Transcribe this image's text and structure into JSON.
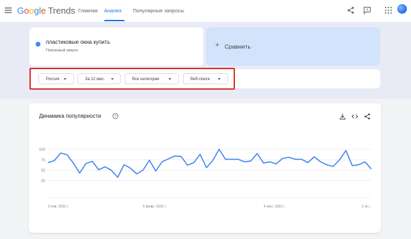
{
  "header": {
    "logo_google": "Google",
    "logo_trends": "Trends",
    "nav": [
      {
        "label": "Главная",
        "active": false
      },
      {
        "label": "Анализ",
        "active": true
      },
      {
        "label": "Популярные запросы",
        "active": false
      }
    ],
    "icons": [
      "menu-icon",
      "share-icon",
      "feedback-icon",
      "apps-grid-icon",
      "avatar"
    ]
  },
  "search_term": {
    "title": "пластиковые окна купить",
    "subtitle": "Поисковый запрос",
    "color": "#4285f4"
  },
  "compare": {
    "label": "Сравнить",
    "icon": "plus-icon"
  },
  "filters": [
    {
      "label": "Россия"
    },
    {
      "label": "За 12 мес."
    },
    {
      "label": "Все категории"
    },
    {
      "label": "Веб-поиск"
    }
  ],
  "highlight_color": "#d93025",
  "chart_card": {
    "title": "Динамика популярности",
    "icons": [
      "help-icon",
      "download-icon",
      "embed-icon",
      "share-icon"
    ]
  },
  "chart_data": {
    "type": "line",
    "ylim": [
      0,
      100
    ],
    "y_ticks": [
      "100",
      "75",
      "50",
      "25"
    ],
    "x_tick_labels": [
      "9 янв. 2022 г.",
      "5 февр. 2022 г.",
      "4 июн. 2022 г.",
      "1 ян..."
    ],
    "grid": true,
    "series": [
      {
        "color": "#4285f4",
        "values": [
          68,
          73,
          91,
          87,
          67,
          43,
          66,
          71,
          51,
          58,
          50,
          33,
          63,
          55,
          41,
          50,
          74,
          48,
          70,
          77,
          84,
          83,
          62,
          68,
          88,
          56,
          73,
          100,
          76,
          76,
          76,
          70,
          72,
          90,
          67,
          70,
          65,
          78,
          81,
          76,
          76,
          68,
          82,
          70,
          63,
          59,
          75,
          97,
          61,
          63,
          70,
          53
        ]
      }
    ]
  }
}
